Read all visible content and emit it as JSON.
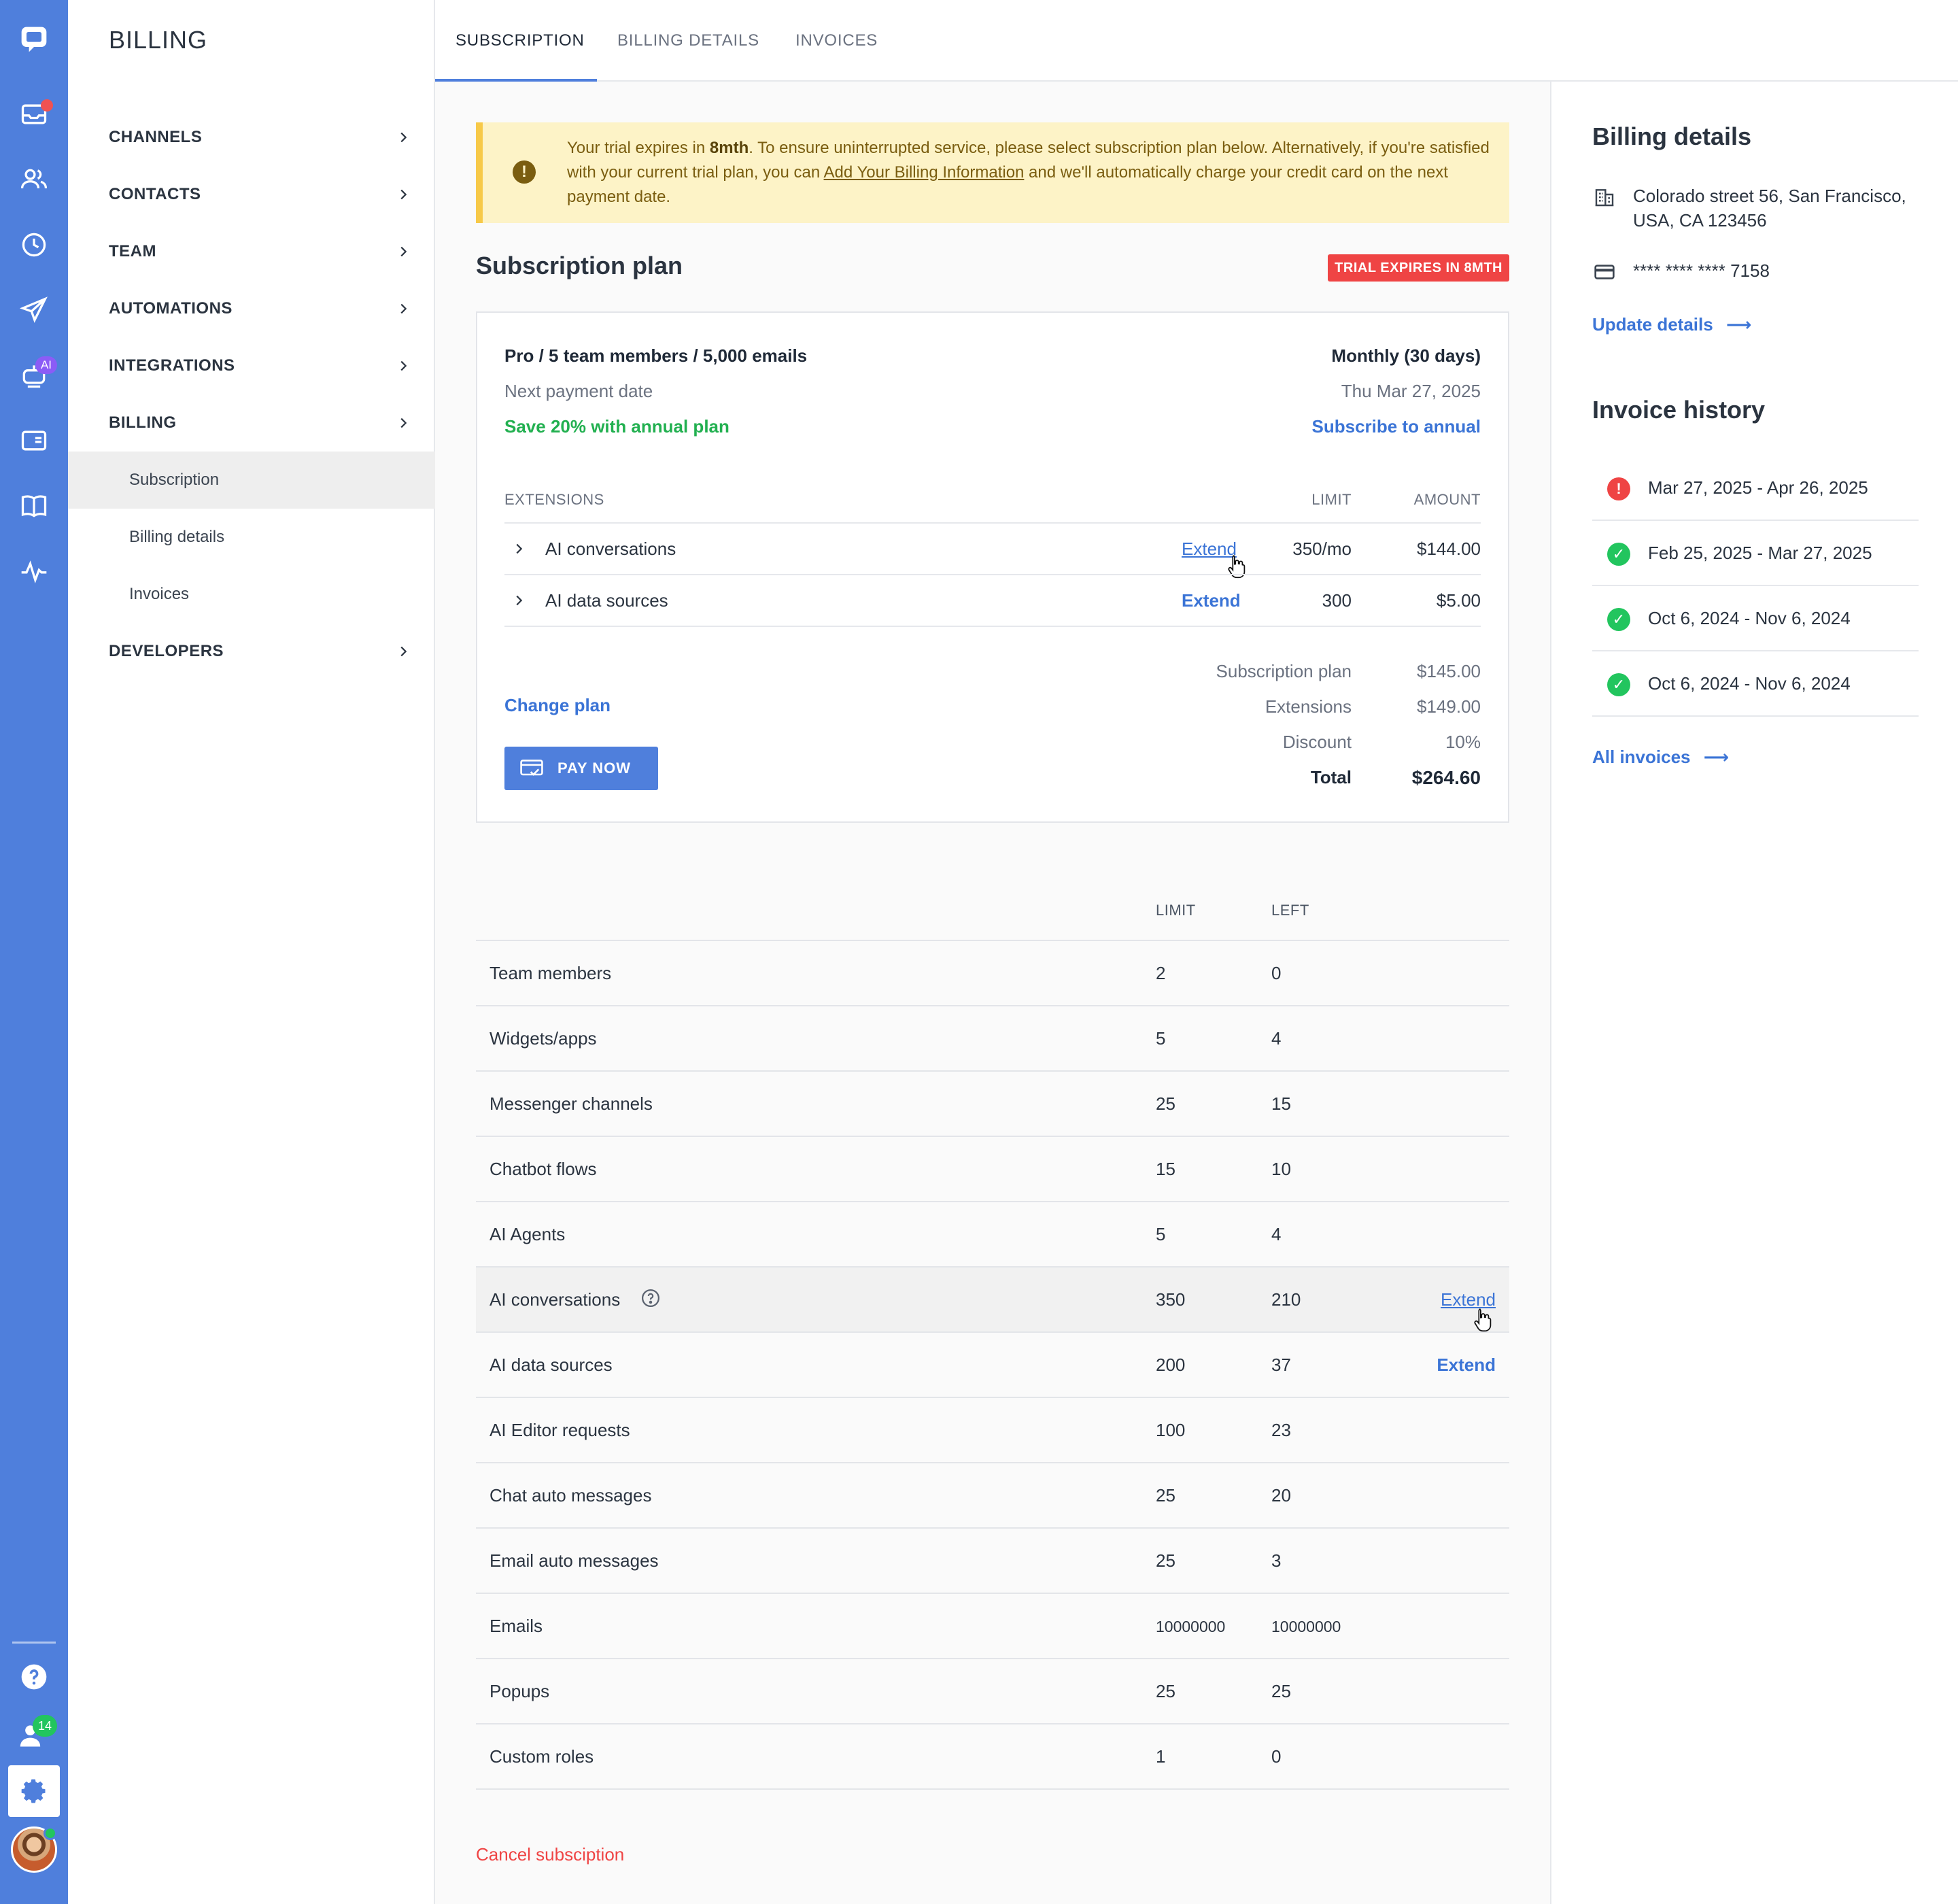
{
  "colors": {
    "accent": "#4f7fdc",
    "link": "#3b74d6",
    "success": "#22c55e",
    "danger": "#ef4444",
    "warning_bg": "#fdf3c7",
    "warning_border": "#f7c948"
  },
  "rail": {
    "icons": [
      "chat-logo-icon",
      "inbox-icon",
      "contacts-icon",
      "history-icon",
      "send-icon",
      "ai-bot-icon",
      "widget-icon",
      "knowledge-book-icon",
      "analytics-icon",
      "help-icon",
      "team-icon",
      "settings-icon",
      "avatar"
    ],
    "ai_badge": "AI",
    "team_badge": "14"
  },
  "sidebar": {
    "title": "BILLING",
    "items": [
      {
        "label": "CHANNELS"
      },
      {
        "label": "CONTACTS"
      },
      {
        "label": "TEAM"
      },
      {
        "label": "AUTOMATIONS"
      },
      {
        "label": "INTEGRATIONS"
      },
      {
        "label": "BILLING"
      },
      {
        "label": "DEVELOPERS"
      }
    ],
    "sub_items": [
      {
        "label": "Subscription",
        "active": true
      },
      {
        "label": "Billing details"
      },
      {
        "label": "Invoices"
      }
    ]
  },
  "tabs": [
    {
      "label": "SUBSCRIPTION",
      "active": true
    },
    {
      "label": "BILLING DETAILS"
    },
    {
      "label": "INVOICES"
    }
  ],
  "notice": {
    "icon": "warning-icon",
    "part1": "Your trial expires in ",
    "bold": "8mth",
    "part2": ". To ensure uninterrupted service, please select subscription plan below. Alternatively, if you're satisfied with your current trial plan, you can ",
    "link": "Add Your Billing Information",
    "part3": " and we'll automatically charge your credit card on the next payment date."
  },
  "plan": {
    "section_title": "Subscription plan",
    "trial_badge": "TRIAL EXPIRES IN 8MTH",
    "name": "Pro / 5 team members / 5,000 emails",
    "period": "Monthly (30 days)",
    "next_payment_label": "Next payment date",
    "next_payment_date": "Thu Mar 27, 2025",
    "save_text": "Save 20% with annual plan",
    "subscribe_annual": "Subscribe to annual",
    "extensions_header": "EXTENSIONS",
    "limit_header": "LIMIT",
    "amount_header": "AMOUNT",
    "extensions": [
      {
        "name": "AI conversations",
        "action": "Extend",
        "limit": "350/mo",
        "amount": "$144.00"
      },
      {
        "name": "AI data sources",
        "action": "Extend",
        "limit": "300",
        "amount": "$5.00"
      }
    ],
    "change_plan": "Change plan",
    "pay_now": "PAY NOW",
    "totals": [
      {
        "label": "Subscription plan",
        "value": "$145.00"
      },
      {
        "label": "Extensions",
        "value": "$149.00"
      },
      {
        "label": "Discount",
        "value": "10%"
      },
      {
        "label": "Total",
        "value": "$264.60"
      }
    ]
  },
  "limits": {
    "headers": {
      "limit": "LIMIT",
      "left": "LEFT"
    },
    "rows": [
      {
        "name": "Team members",
        "limit": "2",
        "left": "0",
        "action": ""
      },
      {
        "name": "Widgets/apps",
        "limit": "5",
        "left": "4",
        "action": ""
      },
      {
        "name": "Messenger channels",
        "limit": "25",
        "left": "15",
        "action": ""
      },
      {
        "name": "Chatbot flows",
        "limit": "15",
        "left": "10",
        "action": ""
      },
      {
        "name": "AI Agents",
        "limit": "5",
        "left": "4",
        "action": ""
      },
      {
        "name": "AI conversations",
        "limit": "350",
        "left": "210",
        "action": "Extend"
      },
      {
        "name": "AI data sources",
        "limit": "200",
        "left": "37",
        "action": "Extend"
      },
      {
        "name": "AI Editor requests",
        "limit": "100",
        "left": "23",
        "action": ""
      },
      {
        "name": "Chat auto messages",
        "limit": "25",
        "left": "20",
        "action": ""
      },
      {
        "name": "Email auto messages",
        "limit": "25",
        "left": "3",
        "action": ""
      },
      {
        "name": "Emails",
        "limit": "10000000",
        "left": "10000000",
        "action": ""
      },
      {
        "name": "Popups",
        "limit": "25",
        "left": "25",
        "action": ""
      },
      {
        "name": "Custom roles",
        "limit": "1",
        "left": "0",
        "action": ""
      }
    ],
    "cancel": "Cancel subsciption"
  },
  "billing_details": {
    "title": "Billing details",
    "address": "Colorado street 56, San Francisco, USA, CA 123456",
    "card": "**** **** **** 7158",
    "update_link": "Update details",
    "arrow": "⟶"
  },
  "invoice_history": {
    "title": "Invoice history",
    "items": [
      {
        "status": "error",
        "range": "Mar 27, 2025  -  Apr 26, 2025"
      },
      {
        "status": "paid",
        "range": "Feb 25, 2025  -  Mar 27, 2025"
      },
      {
        "status": "paid",
        "range": "Oct 6, 2024 - Nov 6, 2024"
      },
      {
        "status": "paid",
        "range": "Oct 6, 2024 - Nov 6, 2024"
      }
    ],
    "all_link": "All invoices",
    "arrow": "⟶"
  }
}
